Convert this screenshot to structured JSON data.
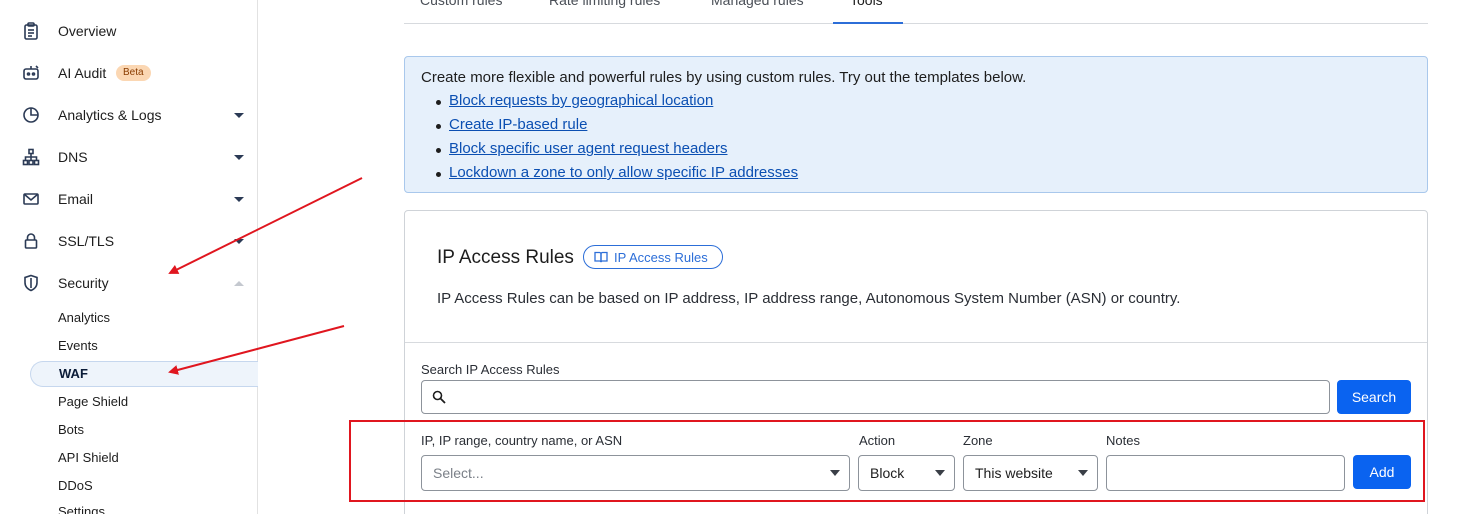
{
  "sidebar": {
    "items": [
      {
        "label": "Overview",
        "icon": "clipboard-icon"
      },
      {
        "label": "AI Audit",
        "icon": "robot-icon",
        "badge": "Beta"
      },
      {
        "label": "Analytics & Logs",
        "icon": "pie-chart-icon"
      },
      {
        "label": "DNS",
        "icon": "network-icon"
      },
      {
        "label": "Email",
        "icon": "envelope-icon"
      },
      {
        "label": "SSL/TLS",
        "icon": "lock-icon"
      },
      {
        "label": "Security",
        "icon": "shield-icon"
      }
    ],
    "security_subitems": [
      "Analytics",
      "Events",
      "WAF",
      "Page Shield",
      "Bots",
      "API Shield",
      "DDoS",
      "Settings"
    ],
    "active_subitem": "WAF"
  },
  "tabs": [
    "Custom rules",
    "Rate limiting rules",
    "Managed rules",
    "Tools"
  ],
  "active_tab": "Tools",
  "callout": {
    "intro": "Create more flexible and powerful rules by using custom rules. Try out the templates below.",
    "links": [
      "Block requests by geographical location",
      "Create IP-based rule",
      "Block specific user agent request headers",
      "Lockdown a zone to only allow specific IP addresses"
    ]
  },
  "ip_access": {
    "title": "IP Access Rules",
    "doc_link": "IP Access Rules",
    "description": "IP Access Rules can be based on IP address, IP address range, Autonomous System Number (ASN) or country.",
    "search_label": "Search IP Access Rules",
    "search_value": "",
    "search_button": "Search",
    "form": {
      "target_label": "IP, IP range, country name, or ASN",
      "target_placeholder": "Select...",
      "action_label": "Action",
      "action_value": "Block",
      "zone_label": "Zone",
      "zone_value": "This website",
      "notes_label": "Notes",
      "notes_value": "",
      "add_button": "Add"
    }
  },
  "colors": {
    "primary": "#0a63f0",
    "link": "#0b4fb2",
    "callout_bg": "#e6f0fb",
    "annotation_red": "#e0161f",
    "beta_badge": "#fbd7b3"
  }
}
